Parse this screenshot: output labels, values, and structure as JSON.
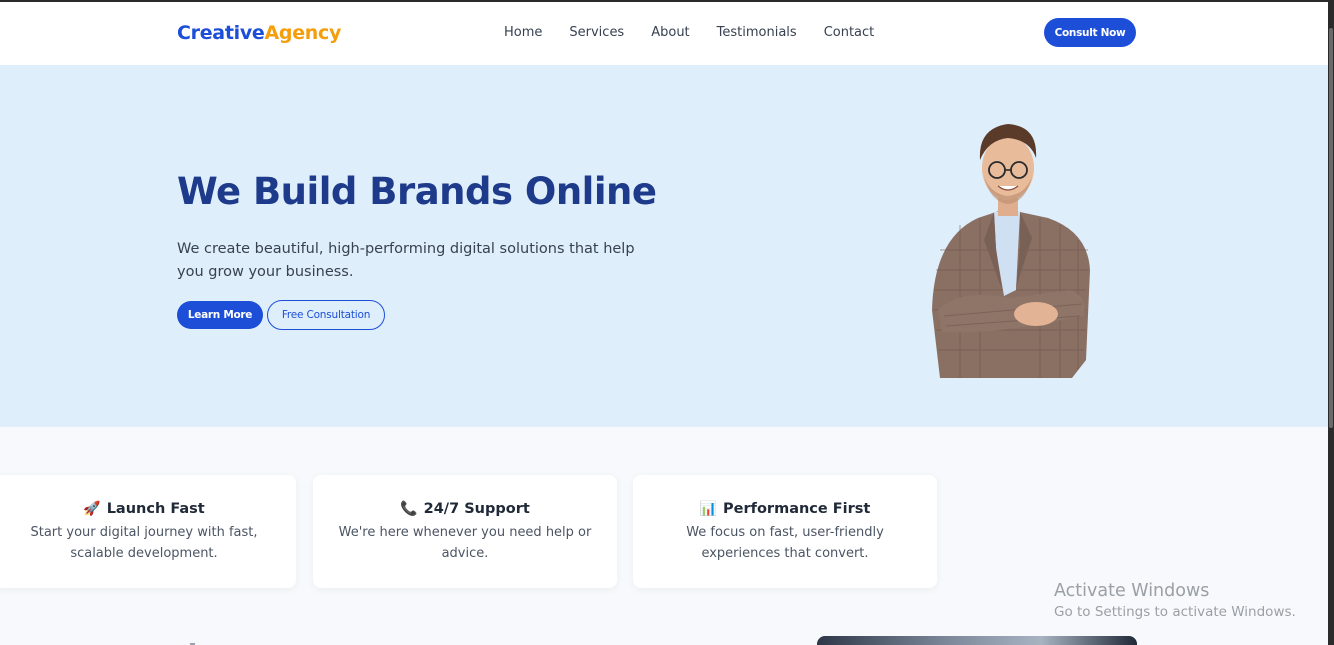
{
  "header": {
    "logo_part1": "Creative",
    "logo_part2": "Agency",
    "nav": [
      "Home",
      "Services",
      "About",
      "Testimonials",
      "Contact"
    ],
    "cta": "Consult Now"
  },
  "hero": {
    "title": "We Build Brands Online",
    "description": "We create beautiful, high-performing digital solutions that help you grow your business.",
    "primary_button": "Learn More",
    "secondary_button": "Free Consultation"
  },
  "features": [
    {
      "icon": "🚀",
      "icon_name": "rocket-icon",
      "title": "Launch Fast",
      "description": "Start your digital journey with fast, scalable development."
    },
    {
      "icon": "📞",
      "icon_name": "phone-icon",
      "title": "24/7 Support",
      "description": "We're here whenever you need help or advice."
    },
    {
      "icon": "📊",
      "icon_name": "chart-icon",
      "title": "Performance First",
      "description": "We focus on fast, user-friendly experiences that convert."
    }
  ],
  "watermark": {
    "line1": "Activate Windows",
    "line2": "Go to Settings to activate Windows."
  },
  "colors": {
    "primary": "#1d4ed8",
    "accent": "#f59e0b",
    "hero_bg": "#dfeefb",
    "title": "#1e3a8a"
  }
}
